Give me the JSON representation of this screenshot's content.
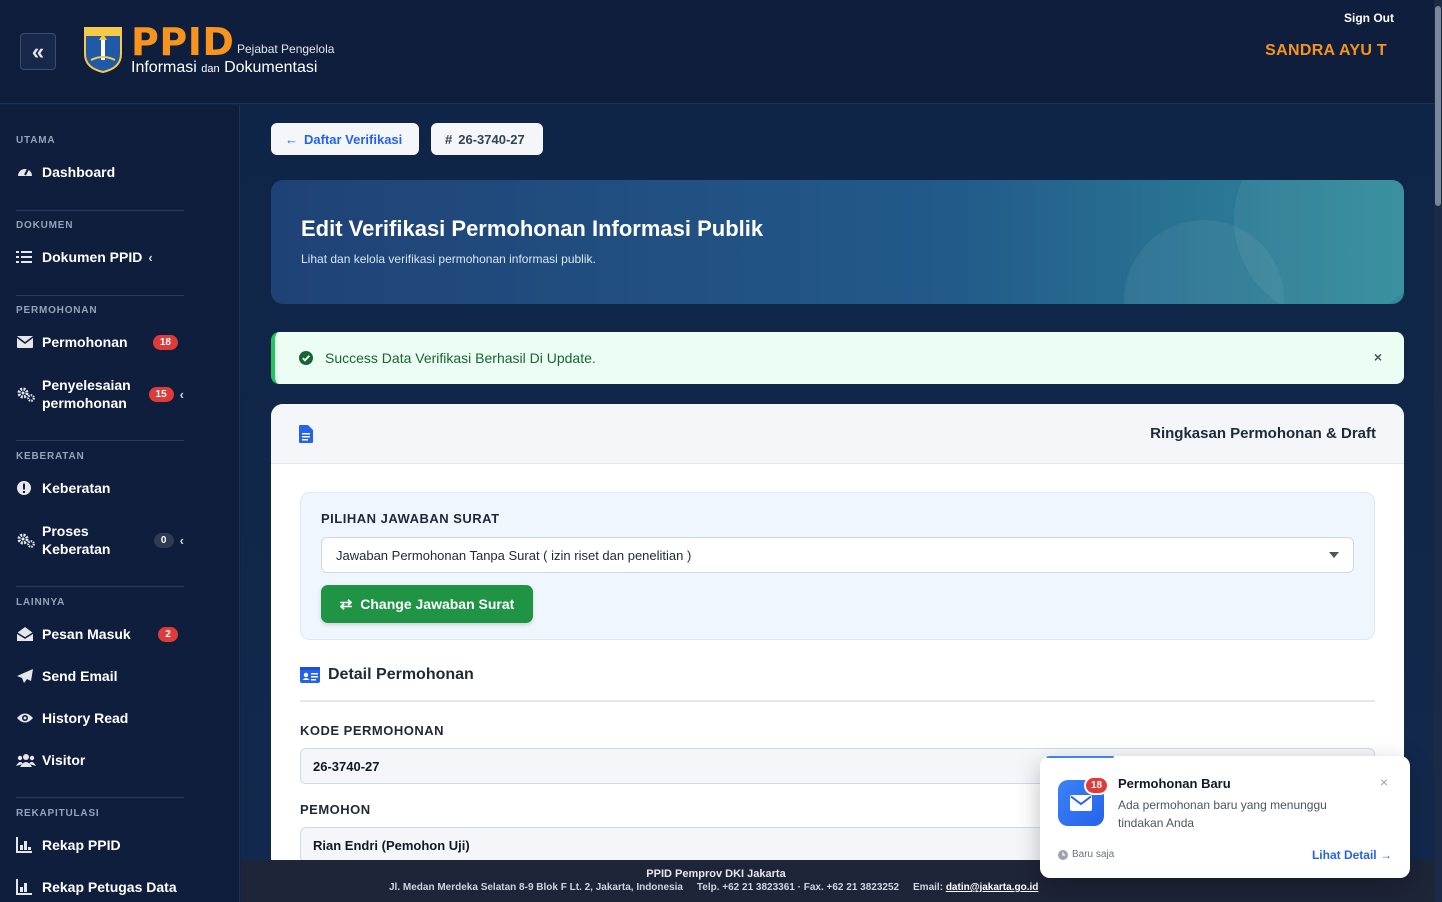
{
  "header": {
    "brand": "PPID",
    "brand_sub1": "Pejabat Pengelola",
    "brand_sub2_a": "Informasi",
    "brand_sub2_b": "dan",
    "brand_sub2_c": "Dokumentasi",
    "sign_out": "Sign Out",
    "user": "SANDRA AYU T"
  },
  "sidebar": {
    "sections": {
      "utama": "UTAMA",
      "dokumen": "DOKUMEN",
      "permohonan": "PERMOHONAN",
      "keberatan": "KEBERATAN",
      "lainnya": "LAINNYA",
      "rekapitulasi": "REKAPITULASI"
    },
    "items": {
      "dashboard": "Dashboard",
      "dokumen_ppid": "Dokumen PPID",
      "permohonan": "Permohonan",
      "permohonan_badge": "18",
      "penyelesaian_1": "Penyelesaian",
      "penyelesaian_2": "permohonan",
      "penyelesaian_badge": "15",
      "keberatan": "Keberatan",
      "proses_1": "Proses",
      "proses_2": "Keberatan",
      "proses_badge": "0",
      "pesan_masuk": "Pesan Masuk",
      "pesan_badge": "2",
      "send_email": "Send Email",
      "history_read": "History Read",
      "visitor": "Visitor",
      "rekap_ppid": "Rekap PPID",
      "rekap_petugas": "Rekap Petugas Data"
    }
  },
  "main": {
    "back_label": "Daftar Verifikasi",
    "code_label": "26-3740-27",
    "hero_title": "Edit Verifikasi Permohonan Informasi Publik",
    "hero_subtitle": "Lihat dan kelola verifikasi permohonan informasi publik.",
    "alert_text": "Success Data Verifikasi Berhasil Di Update.",
    "card_title": "Ringkasan Permohonan & Draft",
    "choice_label": "PILIHAN JAWABAN SURAT",
    "choice_value": "Jawaban Permohonan Tanpa Surat ( izin riset dan penelitian )",
    "change_button": "Change Jawaban Surat",
    "detail_title": "Detail Permohonan",
    "kode_label": "KODE PERMOHONAN",
    "kode_value": "26-3740-27",
    "pemohon_label": "PEMOHON",
    "pemohon_value": "Rian Endri (Pemohon Uji)"
  },
  "footer": {
    "title": "PPID Pemprov DKI Jakarta",
    "address": "Jl. Medan Merdeka Selatan 8-9 Blok F Lt. 2, Jakarta, Indonesia",
    "phone": "Telp. +62 21 3823361 · Fax. +62 21 3823252",
    "email_label": "Email:",
    "email": "datin@jakarta.go.id"
  },
  "toast": {
    "badge": "18",
    "title": "Permohonan Baru",
    "body": "Ada permohonan baru yang menunggu tindakan Anda",
    "time": "Baru saja",
    "link": "Lihat Detail"
  },
  "colors": {
    "brand_orange": "#f7941d",
    "sidebar_bg": "#0f1e3d",
    "badge_red": "#e03b3b",
    "success_green": "#1f9445",
    "link_blue": "#2563eb"
  }
}
